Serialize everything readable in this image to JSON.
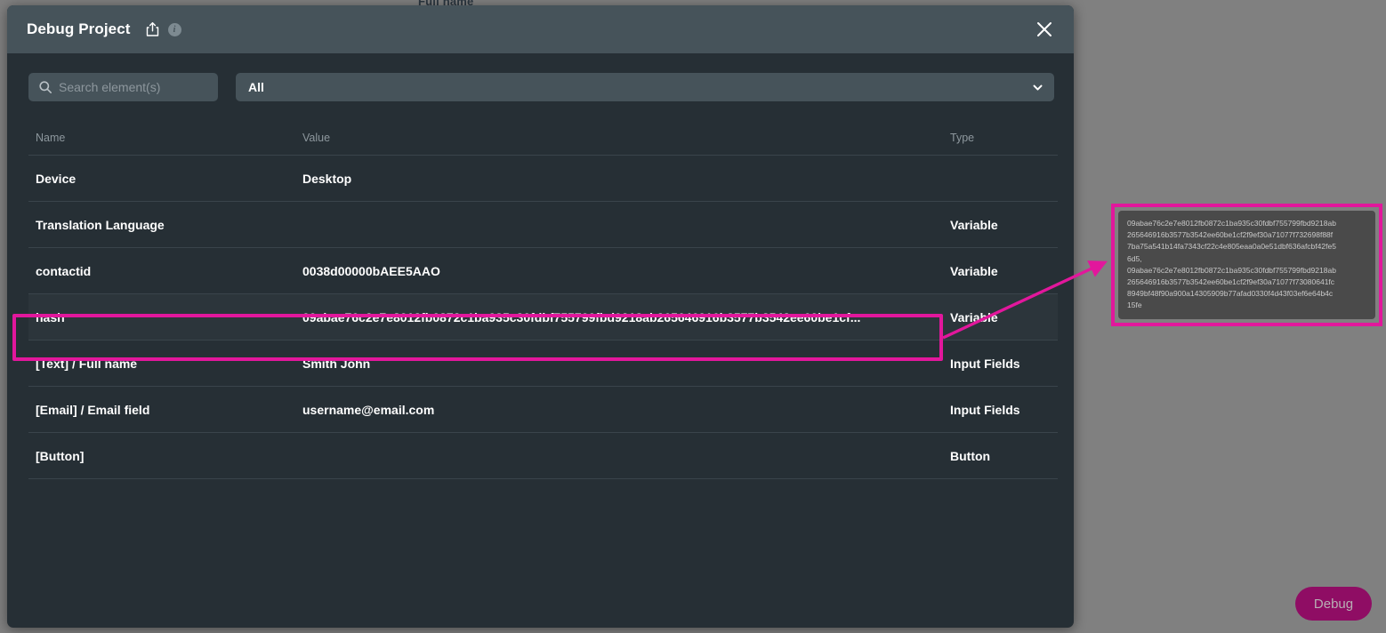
{
  "background": {
    "clipped_field_label": "Full name",
    "overlay_color": "#808080"
  },
  "fab": {
    "label": "Debug",
    "color": "#8f0d64"
  },
  "panel": {
    "title": "Debug Project",
    "icons": {
      "share": "share-icon",
      "info": "info-icon",
      "close": "close-icon"
    },
    "search": {
      "placeholder": "Search element(s)",
      "value": "",
      "icon": "search-icon"
    },
    "filter": {
      "selected": "All",
      "icon": "chevron-down-icon"
    },
    "table": {
      "columns": [
        "Name",
        "Value",
        "Type"
      ],
      "rows": [
        {
          "name": "Device",
          "value": "Desktop",
          "type": ""
        },
        {
          "name": "Translation Language",
          "value": "",
          "type": "Variable"
        },
        {
          "name": "contactid",
          "value": "0038d00000bAEE5AAO",
          "type": "Variable"
        },
        {
          "name": "hash",
          "value": "09abae76c2e7e8012fb0872c1ba935c30fdbf755799fbd9218ab265646916b3577b3542ee60be1cf...",
          "type": "Variable"
        },
        {
          "name": "[Text] / Full name",
          "value": "Smith John",
          "type": "Input Fields"
        },
        {
          "name": "[Email] / Email field",
          "value": "username@email.com",
          "type": "Input Fields"
        },
        {
          "name": "[Button]",
          "value": "",
          "type": "Button"
        }
      ]
    }
  },
  "annotation": {
    "color": "#e2179c",
    "tooltip_lines": [
      "09abae76c2e7e8012fb0872c1ba935c30fdbf755799fbd9218ab",
      "265646916b3577b3542ee60be1cf2f9ef30a71077f732698f88f",
      "7ba75a541b14fa7343cf22c4e805eaa0a0e51dbf636afcbf42fe5",
      "6d5,",
      "09abae76c2e7e8012fb0872c1ba935c30fdbf755799fbd9218ab",
      "265646916b3577b3542ee60be1cf2f9ef30a71077f73080641fc",
      "8949bf48f90a900a14305909b77afad0330f4d43f03ef6e64b4c",
      "15fe"
    ]
  }
}
